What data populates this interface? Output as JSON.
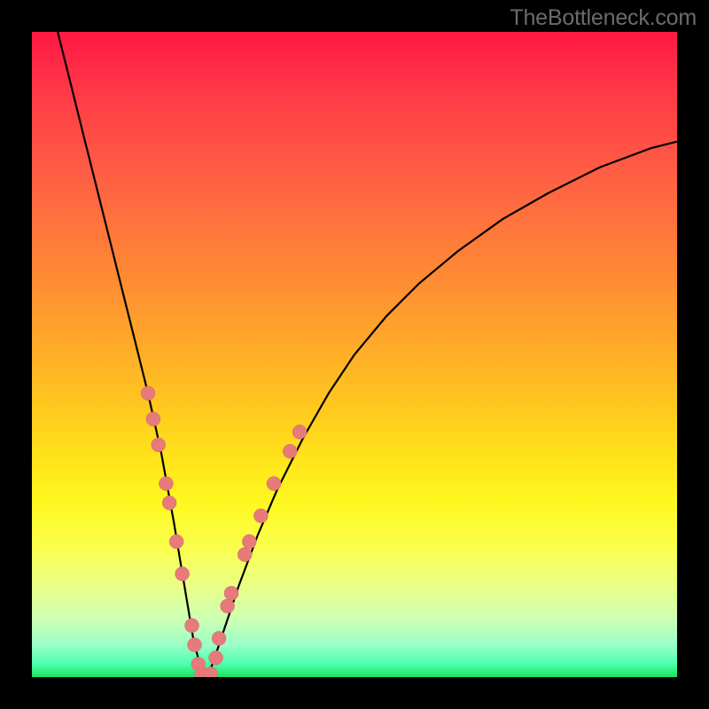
{
  "watermark": "TheBottleneck.com",
  "colors": {
    "dot_fill": "#e77a7a",
    "dot_stroke": "#d66868",
    "curve_stroke": "#000000"
  },
  "chart_data": {
    "type": "line",
    "title": "",
    "xlabel": "",
    "ylabel": "",
    "xlim": [
      0,
      100
    ],
    "ylim": [
      0,
      100
    ],
    "series": [
      {
        "name": "curve",
        "x": [
          4,
          6,
          8,
          10,
          12,
          14,
          16,
          18,
          20,
          22,
          23,
          24,
          25,
          26,
          27,
          28,
          30,
          32,
          35,
          38,
          42,
          46,
          50,
          55,
          60,
          66,
          73,
          80,
          88,
          96,
          100
        ],
        "y": [
          100,
          92,
          84,
          76,
          68,
          60,
          52,
          44,
          35,
          24,
          18,
          12,
          6,
          2,
          0,
          2,
          8,
          14,
          22,
          29,
          37,
          44,
          50,
          56,
          61,
          66,
          71,
          75,
          79,
          82,
          83
        ]
      }
    ],
    "dots_left": [
      {
        "x": 18.0,
        "y": 44
      },
      {
        "x": 18.8,
        "y": 40
      },
      {
        "x": 19.6,
        "y": 36
      },
      {
        "x": 20.8,
        "y": 30
      },
      {
        "x": 21.3,
        "y": 27
      },
      {
        "x": 22.4,
        "y": 21
      },
      {
        "x": 23.3,
        "y": 16
      },
      {
        "x": 24.8,
        "y": 8
      },
      {
        "x": 25.2,
        "y": 5
      },
      {
        "x": 25.8,
        "y": 2
      }
    ],
    "dots_bottom": [
      {
        "x": 26.3,
        "y": 0.5
      },
      {
        "x": 27.0,
        "y": 0.2
      },
      {
        "x": 27.7,
        "y": 0.5
      }
    ],
    "dots_right": [
      {
        "x": 28.5,
        "y": 3
      },
      {
        "x": 29.0,
        "y": 6
      },
      {
        "x": 30.3,
        "y": 11
      },
      {
        "x": 30.9,
        "y": 13
      },
      {
        "x": 33.0,
        "y": 19
      },
      {
        "x": 33.7,
        "y": 21
      },
      {
        "x": 35.5,
        "y": 25
      },
      {
        "x": 37.5,
        "y": 30
      },
      {
        "x": 40.0,
        "y": 35
      },
      {
        "x": 41.5,
        "y": 38
      }
    ]
  }
}
